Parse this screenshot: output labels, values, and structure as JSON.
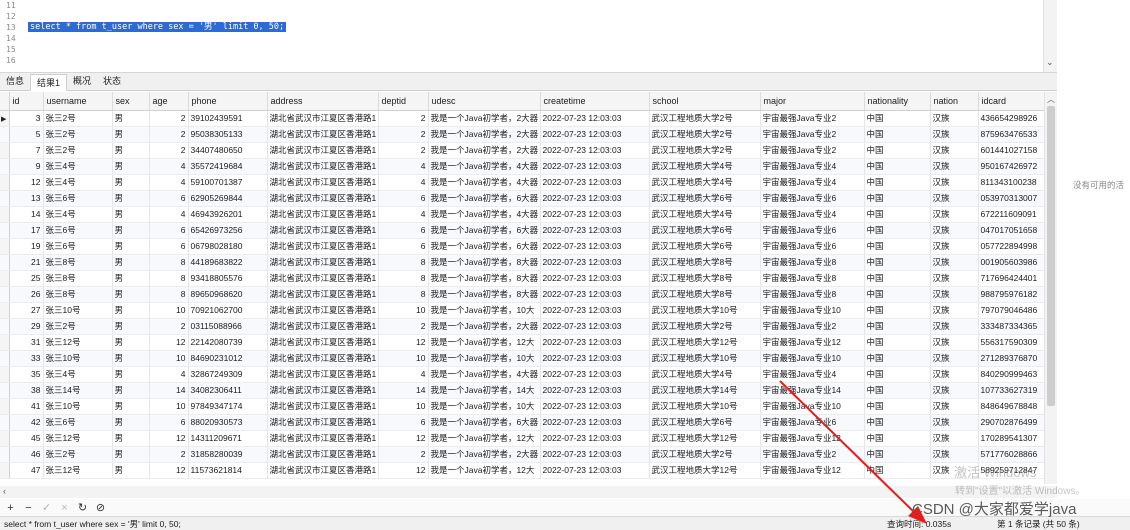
{
  "editor": {
    "lines": [
      {
        "num": "11",
        "text": ""
      },
      {
        "num": "12",
        "text": ""
      },
      {
        "num": "13",
        "text": "select * from t_user where sex = '男' limit 0, 50;"
      },
      {
        "num": "14",
        "text": ""
      },
      {
        "num": "15",
        "text": ""
      },
      {
        "num": "16",
        "text": ""
      }
    ]
  },
  "tabs": [
    "信息",
    "结果1",
    "概况",
    "状态"
  ],
  "active_tab": 1,
  "columns": [
    "id",
    "username",
    "sex",
    "age",
    "phone",
    "address",
    "deptid",
    "udesc",
    "createtime",
    "school",
    "major",
    "nationality",
    "nation",
    "idcard"
  ],
  "rows": [
    [
      "3",
      "张三2号",
      "男",
      "2",
      "39102439591",
      "湖北省武汉市江夏区香港路1",
      "2",
      "我是一个Java初学者，2大器",
      "2022-07-23 12:03:03",
      "武汉工程地质大学2号",
      "宇宙最强Java专业2",
      "中国",
      "汉族",
      "436654298926"
    ],
    [
      "5",
      "张三2号",
      "男",
      "2",
      "95038305133",
      "湖北省武汉市江夏区香港路1",
      "2",
      "我是一个Java初学者，2大器",
      "2022-07-23 12:03:03",
      "武汉工程地质大学2号",
      "宇宙最强Java专业2",
      "中国",
      "汉族",
      "875963476533"
    ],
    [
      "7",
      "张三2号",
      "男",
      "2",
      "34407480650",
      "湖北省武汉市江夏区香港路1",
      "2",
      "我是一个Java初学者，2大器",
      "2022-07-23 12:03:03",
      "武汉工程地质大学2号",
      "宇宙最强Java专业2",
      "中国",
      "汉族",
      "601441027158"
    ],
    [
      "9",
      "张三4号",
      "男",
      "4",
      "35572419684",
      "湖北省武汉市江夏区香港路1",
      "4",
      "我是一个Java初学者，4大器",
      "2022-07-23 12:03:03",
      "武汉工程地质大学4号",
      "宇宙最强Java专业4",
      "中国",
      "汉族",
      "950167426972"
    ],
    [
      "12",
      "张三4号",
      "男",
      "4",
      "59100701387",
      "湖北省武汉市江夏区香港路1",
      "4",
      "我是一个Java初学者，4大器",
      "2022-07-23 12:03:03",
      "武汉工程地质大学4号",
      "宇宙最强Java专业4",
      "中国",
      "汉族",
      "811343100238"
    ],
    [
      "13",
      "张三6号",
      "男",
      "6",
      "62905269844",
      "湖北省武汉市江夏区香港路1",
      "6",
      "我是一个Java初学者，6大器",
      "2022-07-23 12:03:03",
      "武汉工程地质大学6号",
      "宇宙最强Java专业6",
      "中国",
      "汉族",
      "053970313007"
    ],
    [
      "14",
      "张三4号",
      "男",
      "4",
      "46943926201",
      "湖北省武汉市江夏区香港路1",
      "4",
      "我是一个Java初学者，4大器",
      "2022-07-23 12:03:03",
      "武汉工程地质大学4号",
      "宇宙最强Java专业4",
      "中国",
      "汉族",
      "672211609091"
    ],
    [
      "17",
      "张三6号",
      "男",
      "6",
      "65426973256",
      "湖北省武汉市江夏区香港路1",
      "6",
      "我是一个Java初学者，6大器",
      "2022-07-23 12:03:03",
      "武汉工程地质大学6号",
      "宇宙最强Java专业6",
      "中国",
      "汉族",
      "047017051658"
    ],
    [
      "19",
      "张三6号",
      "男",
      "6",
      "06798028180",
      "湖北省武汉市江夏区香港路1",
      "6",
      "我是一个Java初学者，6大器",
      "2022-07-23 12:03:03",
      "武汉工程地质大学6号",
      "宇宙最强Java专业6",
      "中国",
      "汉族",
      "057722894998"
    ],
    [
      "21",
      "张三8号",
      "男",
      "8",
      "44189683822",
      "湖北省武汉市江夏区香港路1",
      "8",
      "我是一个Java初学者，8大器",
      "2022-07-23 12:03:03",
      "武汉工程地质大学8号",
      "宇宙最强Java专业8",
      "中国",
      "汉族",
      "001905603986"
    ],
    [
      "25",
      "张三8号",
      "男",
      "8",
      "93418805576",
      "湖北省武汉市江夏区香港路1",
      "8",
      "我是一个Java初学者，8大器",
      "2022-07-23 12:03:03",
      "武汉工程地质大学8号",
      "宇宙最强Java专业8",
      "中国",
      "汉族",
      "717696424401"
    ],
    [
      "26",
      "张三8号",
      "男",
      "8",
      "89650968620",
      "湖北省武汉市江夏区香港路1",
      "8",
      "我是一个Java初学者，8大器",
      "2022-07-23 12:03:03",
      "武汉工程地质大学8号",
      "宇宙最强Java专业8",
      "中国",
      "汉族",
      "988795976182"
    ],
    [
      "27",
      "张三10号",
      "男",
      "10",
      "70921062700",
      "湖北省武汉市江夏区香港路1",
      "10",
      "我是一个Java初学者，10大",
      "2022-07-23 12:03:03",
      "武汉工程地质大学10号",
      "宇宙最强Java专业10",
      "中国",
      "汉族",
      "797079046486"
    ],
    [
      "29",
      "张三2号",
      "男",
      "2",
      "03115088966",
      "湖北省武汉市江夏区香港路1",
      "2",
      "我是一个Java初学者，2大器",
      "2022-07-23 12:03:03",
      "武汉工程地质大学2号",
      "宇宙最强Java专业2",
      "中国",
      "汉族",
      "333487334365"
    ],
    [
      "31",
      "张三12号",
      "男",
      "12",
      "22142080739",
      "湖北省武汉市江夏区香港路1",
      "12",
      "我是一个Java初学者，12大",
      "2022-07-23 12:03:03",
      "武汉工程地质大学12号",
      "宇宙最强Java专业12",
      "中国",
      "汉族",
      "556317590309"
    ],
    [
      "33",
      "张三10号",
      "男",
      "10",
      "84690231012",
      "湖北省武汉市江夏区香港路1",
      "10",
      "我是一个Java初学者，10大",
      "2022-07-23 12:03:03",
      "武汉工程地质大学10号",
      "宇宙最强Java专业10",
      "中国",
      "汉族",
      "271289376870"
    ],
    [
      "35",
      "张三4号",
      "男",
      "4",
      "32867249309",
      "湖北省武汉市江夏区香港路1",
      "4",
      "我是一个Java初学者，4大器",
      "2022-07-23 12:03:03",
      "武汉工程地质大学4号",
      "宇宙最强Java专业4",
      "中国",
      "汉族",
      "840290999463"
    ],
    [
      "38",
      "张三14号",
      "男",
      "14",
      "34082306411",
      "湖北省武汉市江夏区香港路1",
      "14",
      "我是一个Java初学者，14大",
      "2022-07-23 12:03:03",
      "武汉工程地质大学14号",
      "宇宙最强Java专业14",
      "中国",
      "汉族",
      "107733627319"
    ],
    [
      "41",
      "张三10号",
      "男",
      "10",
      "97849347174",
      "湖北省武汉市江夏区香港路1",
      "10",
      "我是一个Java初学者，10大",
      "2022-07-23 12:03:03",
      "武汉工程地质大学10号",
      "宇宙最强Java专业10",
      "中国",
      "汉族",
      "848649678848"
    ],
    [
      "42",
      "张三6号",
      "男",
      "6",
      "88020930573",
      "湖北省武汉市江夏区香港路1",
      "6",
      "我是一个Java初学者，6大器",
      "2022-07-23 12:03:03",
      "武汉工程地质大学6号",
      "宇宙最强Java专业6",
      "中国",
      "汉族",
      "290702876499"
    ],
    [
      "45",
      "张三12号",
      "男",
      "12",
      "14311209671",
      "湖北省武汉市江夏区香港路1",
      "12",
      "我是一个Java初学者，12大",
      "2022-07-23 12:03:03",
      "武汉工程地质大学12号",
      "宇宙最强Java专业12",
      "中国",
      "汉族",
      "170289541307"
    ],
    [
      "46",
      "张三2号",
      "男",
      "2",
      "31858280039",
      "湖北省武汉市江夏区香港路1",
      "2",
      "我是一个Java初学者，2大器",
      "2022-07-23 12:03:03",
      "武汉工程地质大学2号",
      "宇宙最强Java专业2",
      "中国",
      "汉族",
      "571776028866"
    ],
    [
      "47",
      "张三12号",
      "男",
      "12",
      "11573621814",
      "湖北省武汉市江夏区香港路1",
      "12",
      "我是一个Java初学者，12大",
      "2022-07-23 12:03:03",
      "武汉工程地质大学12号",
      "宇宙最强Java专业12",
      "中国",
      "汉族",
      "589259712847"
    ]
  ],
  "side_hint": "没有可用的活",
  "status": {
    "sql": "select * from t_user where sex = '男' limit 0, 50;",
    "time": "查询时间: 0.035s",
    "records": "第 1 条记录 (共 50 条)"
  },
  "watermark": {
    "activate": "激活 Windows",
    "activate_hint": "转到\"设置\"以激活 Windows。",
    "csdn": "CSDN @大家都爱学java"
  },
  "colors": {
    "selection": "#2d6bd4",
    "annotation_arrow": "#e02020"
  }
}
